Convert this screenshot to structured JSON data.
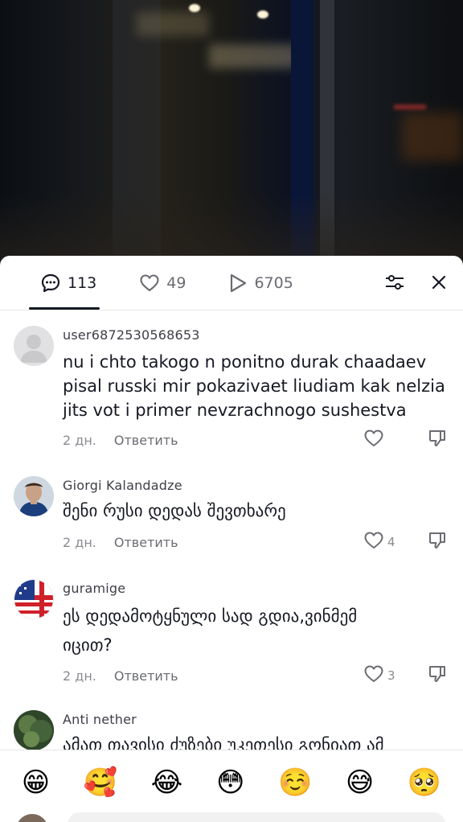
{
  "tabs": {
    "comments_count": "113",
    "likes_count": "49",
    "views_count": "6705"
  },
  "comments": [
    {
      "username": "user6872530568653",
      "text": "nu i chto takogo n ponitno durak chaadaev pisal russki mir pokazivaet liudiam kak nelzia jits vot i primer nevzrachnogo sushestva",
      "time": "2 дн.",
      "reply_label": "Ответить",
      "likes": ""
    },
    {
      "username": "Giorgi Kalandadze",
      "text": "შენი რუსი დედას შევთხარე",
      "time": "2 дн.",
      "reply_label": "Ответить",
      "likes": "4"
    },
    {
      "username": "guramige",
      "text": "ეს დედამოტყნული სად გდია,ვინმემ იცით?",
      "time": "2 дн.",
      "reply_label": "Ответить",
      "likes": "3"
    },
    {
      "username": "Anti nether",
      "text": "ამათ თავისი ძუზები უკეთესი გონიათ ამ",
      "time": "",
      "reply_label": "",
      "likes": ""
    }
  ],
  "emojis": [
    "😁",
    "🥰",
    "😂",
    "😳",
    "☺️",
    "😅",
    "🥺"
  ],
  "colors": {
    "text_primary": "#161823",
    "text_secondary": "#8a8b91",
    "divider": "#e6e6e6"
  }
}
